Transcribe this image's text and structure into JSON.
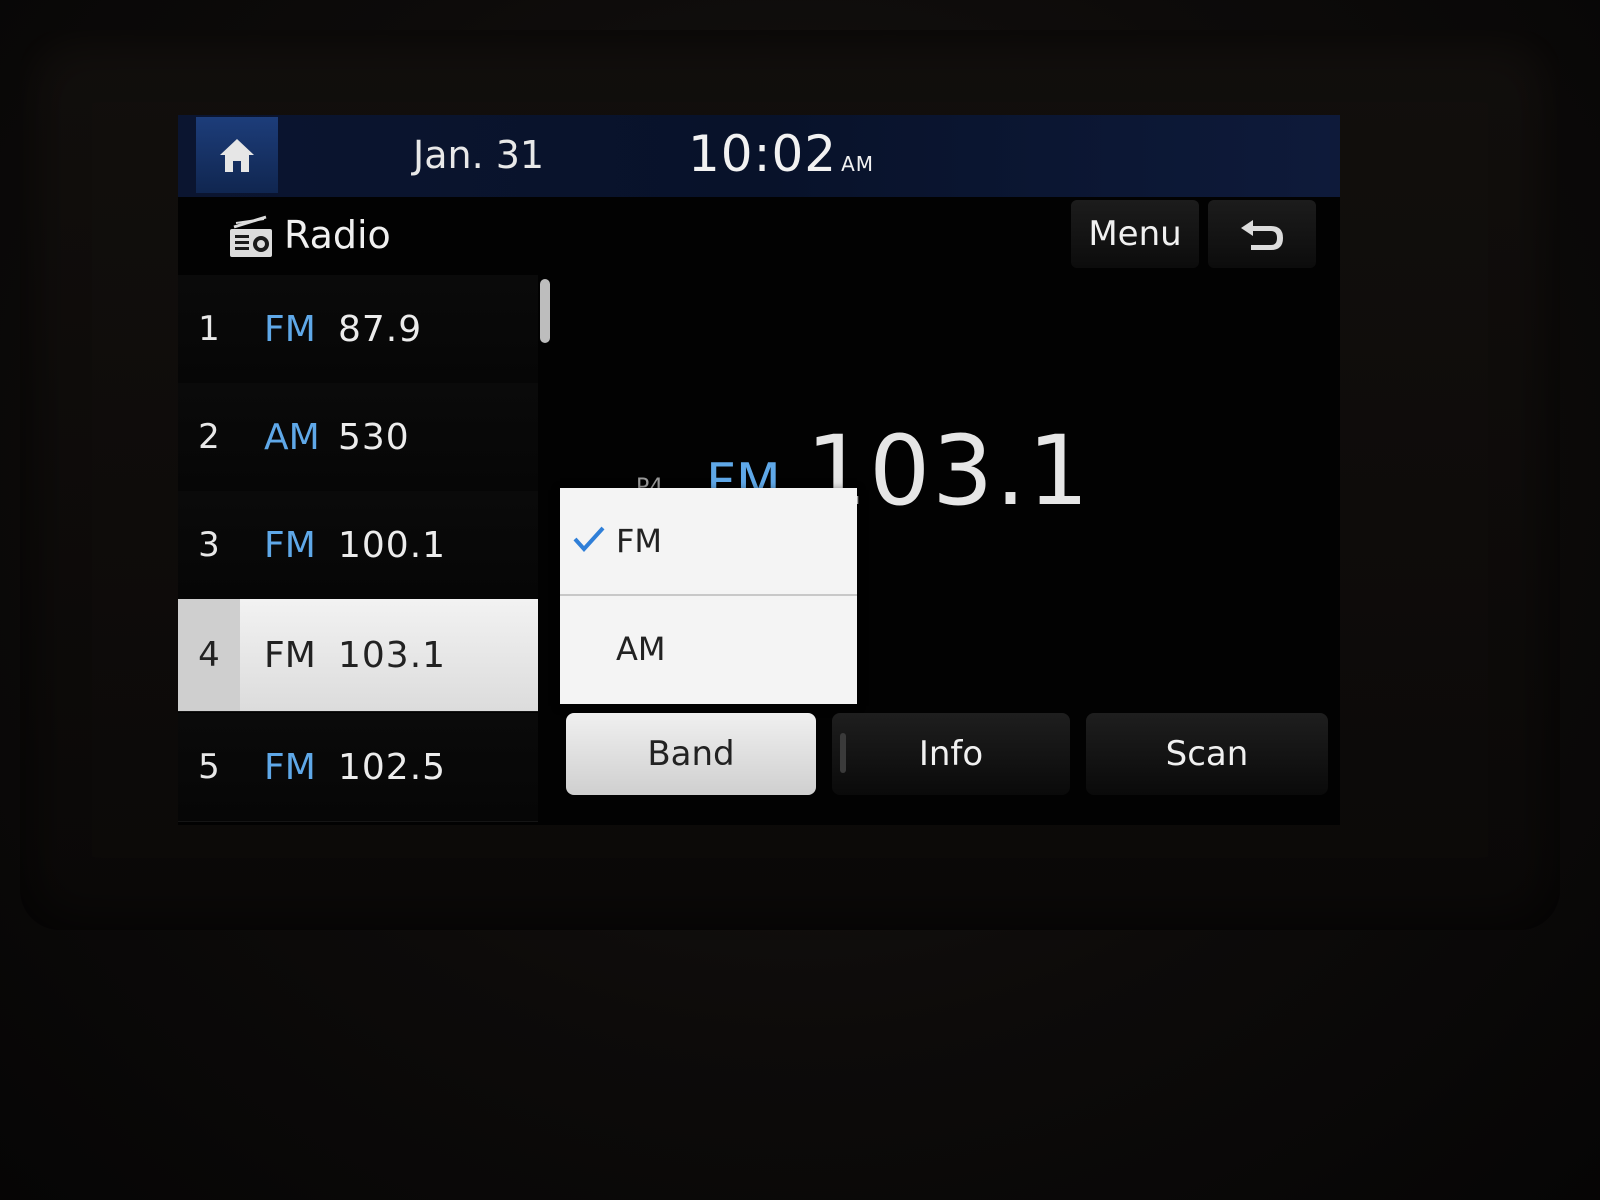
{
  "status_bar": {
    "home_icon": "home-icon",
    "date": "Jan. 31",
    "time": "10:02",
    "ampm": "AM"
  },
  "header": {
    "icon": "radio-icon",
    "title": "Radio",
    "menu_label": "Menu",
    "back_icon": "back-arrow-icon"
  },
  "presets": [
    {
      "number": "1",
      "band": "FM",
      "frequency": "87.9",
      "active": false
    },
    {
      "number": "2",
      "band": "AM",
      "frequency": "530",
      "active": false
    },
    {
      "number": "3",
      "band": "FM",
      "frequency": "100.1",
      "active": false
    },
    {
      "number": "4",
      "band": "FM",
      "frequency": "103.1",
      "active": true
    },
    {
      "number": "5",
      "band": "FM",
      "frequency": "102.5",
      "active": false
    }
  ],
  "now_playing": {
    "preset_tag": "P4",
    "band": "FM",
    "frequency": "103.1"
  },
  "band_dropdown": {
    "options": [
      {
        "label": "FM",
        "selected": true
      },
      {
        "label": "AM",
        "selected": false
      }
    ]
  },
  "bottom_buttons": {
    "band": "Band",
    "info": "Info",
    "scan": "Scan"
  },
  "colors": {
    "accent_blue": "#5fa8e8",
    "check_blue": "#2f7fd8",
    "status_bar_blue": "#0b1530"
  }
}
